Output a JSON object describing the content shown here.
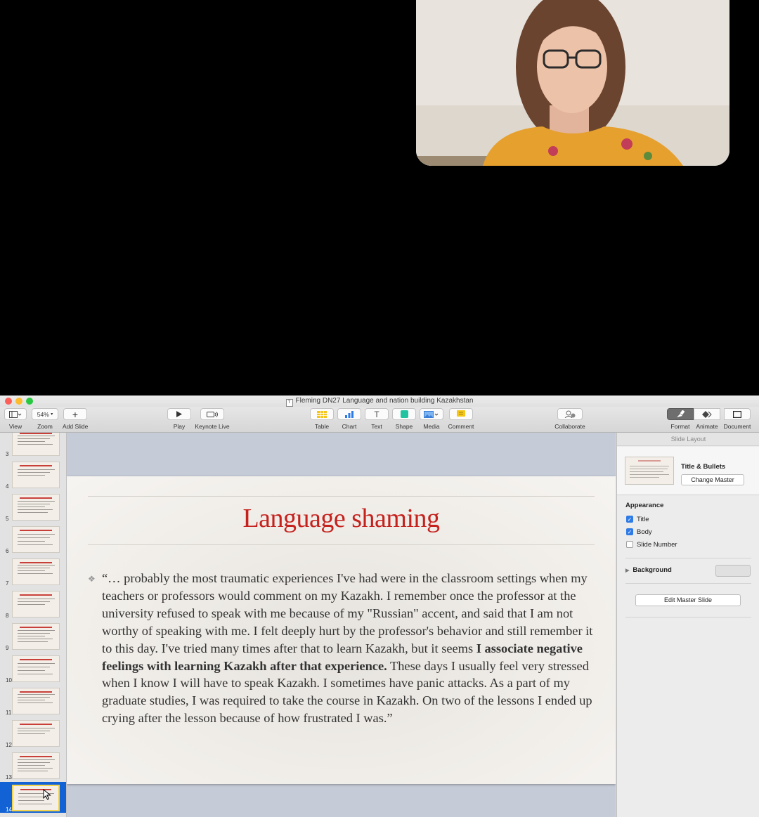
{
  "window": {
    "title": "Fleming DN27 Language and nation building Kazakhstan",
    "doc_icon": "T"
  },
  "toolbar": {
    "view": {
      "label": "View",
      "icon": "view-icon"
    },
    "zoom": {
      "label": "Zoom",
      "value": "54%"
    },
    "add_slide": {
      "label": "Add Slide",
      "icon": "plus-icon"
    },
    "play": {
      "label": "Play",
      "icon": "play-icon"
    },
    "keynote_live": {
      "label": "Keynote Live",
      "icon": "keynote-live-icon"
    },
    "table": {
      "label": "Table",
      "icon": "table-icon"
    },
    "chart": {
      "label": "Chart",
      "icon": "chart-icon"
    },
    "text": {
      "label": "Text",
      "icon": "text-icon",
      "glyph": "T"
    },
    "shape": {
      "label": "Shape",
      "icon": "shape-icon"
    },
    "media": {
      "label": "Media",
      "icon": "media-icon"
    },
    "comment": {
      "label": "Comment",
      "icon": "comment-icon"
    },
    "collaborate": {
      "label": "Collaborate",
      "icon": "collaborate-icon"
    },
    "format": {
      "label": "Format",
      "icon": "format-brush-icon"
    },
    "animate": {
      "label": "Animate",
      "icon": "animate-diamond-icon"
    },
    "document": {
      "label": "Document",
      "icon": "document-icon"
    }
  },
  "navigator": {
    "slides": [
      {
        "number": "3"
      },
      {
        "number": "4"
      },
      {
        "number": "5"
      },
      {
        "number": "6"
      },
      {
        "number": "7"
      },
      {
        "number": "8"
      },
      {
        "number": "9"
      },
      {
        "number": "10"
      },
      {
        "number": "11"
      },
      {
        "number": "12"
      },
      {
        "number": "13"
      },
      {
        "number": "14",
        "selected": true
      }
    ]
  },
  "slide": {
    "title": "Language shaming",
    "body_part1": "“… probably the most traumatic experiences I've had were in the classroom settings when my teachers or professors would comment on my Kazakh. I remember once the professor at the university refused to speak with me because of my \"Russian\" accent, and said that I am not worthy of speaking with me. I felt deeply hurt by the professor's behavior and still remember it to this day. I've tried many times after that to learn Kazakh, but it seems ",
    "body_bold": "I associate negative feelings with learning Kazakh after that experience.",
    "body_part2": " These days I usually feel very stressed when I know I will have to speak Kazakh. I sometimes have panic attacks. As a part of my graduate studies, I was required to take the course in Kazakh. On two of the lessons I ended up crying after the lesson because of how frustrated I was.”",
    "bullet": "❖"
  },
  "inspector": {
    "header": "Slide Layout",
    "layout_name": "Title & Bullets",
    "change_master": "Change Master",
    "appearance_title": "Appearance",
    "options": [
      {
        "label": "Title",
        "checked": true
      },
      {
        "label": "Body",
        "checked": true
      },
      {
        "label": "Slide Number",
        "checked": false
      }
    ],
    "background_label": "Background",
    "edit_master": "Edit Master Slide"
  },
  "colors": {
    "title_red": "#c5211d",
    "selection_blue": "#1262d6",
    "checkbox_blue": "#2f7be6"
  }
}
